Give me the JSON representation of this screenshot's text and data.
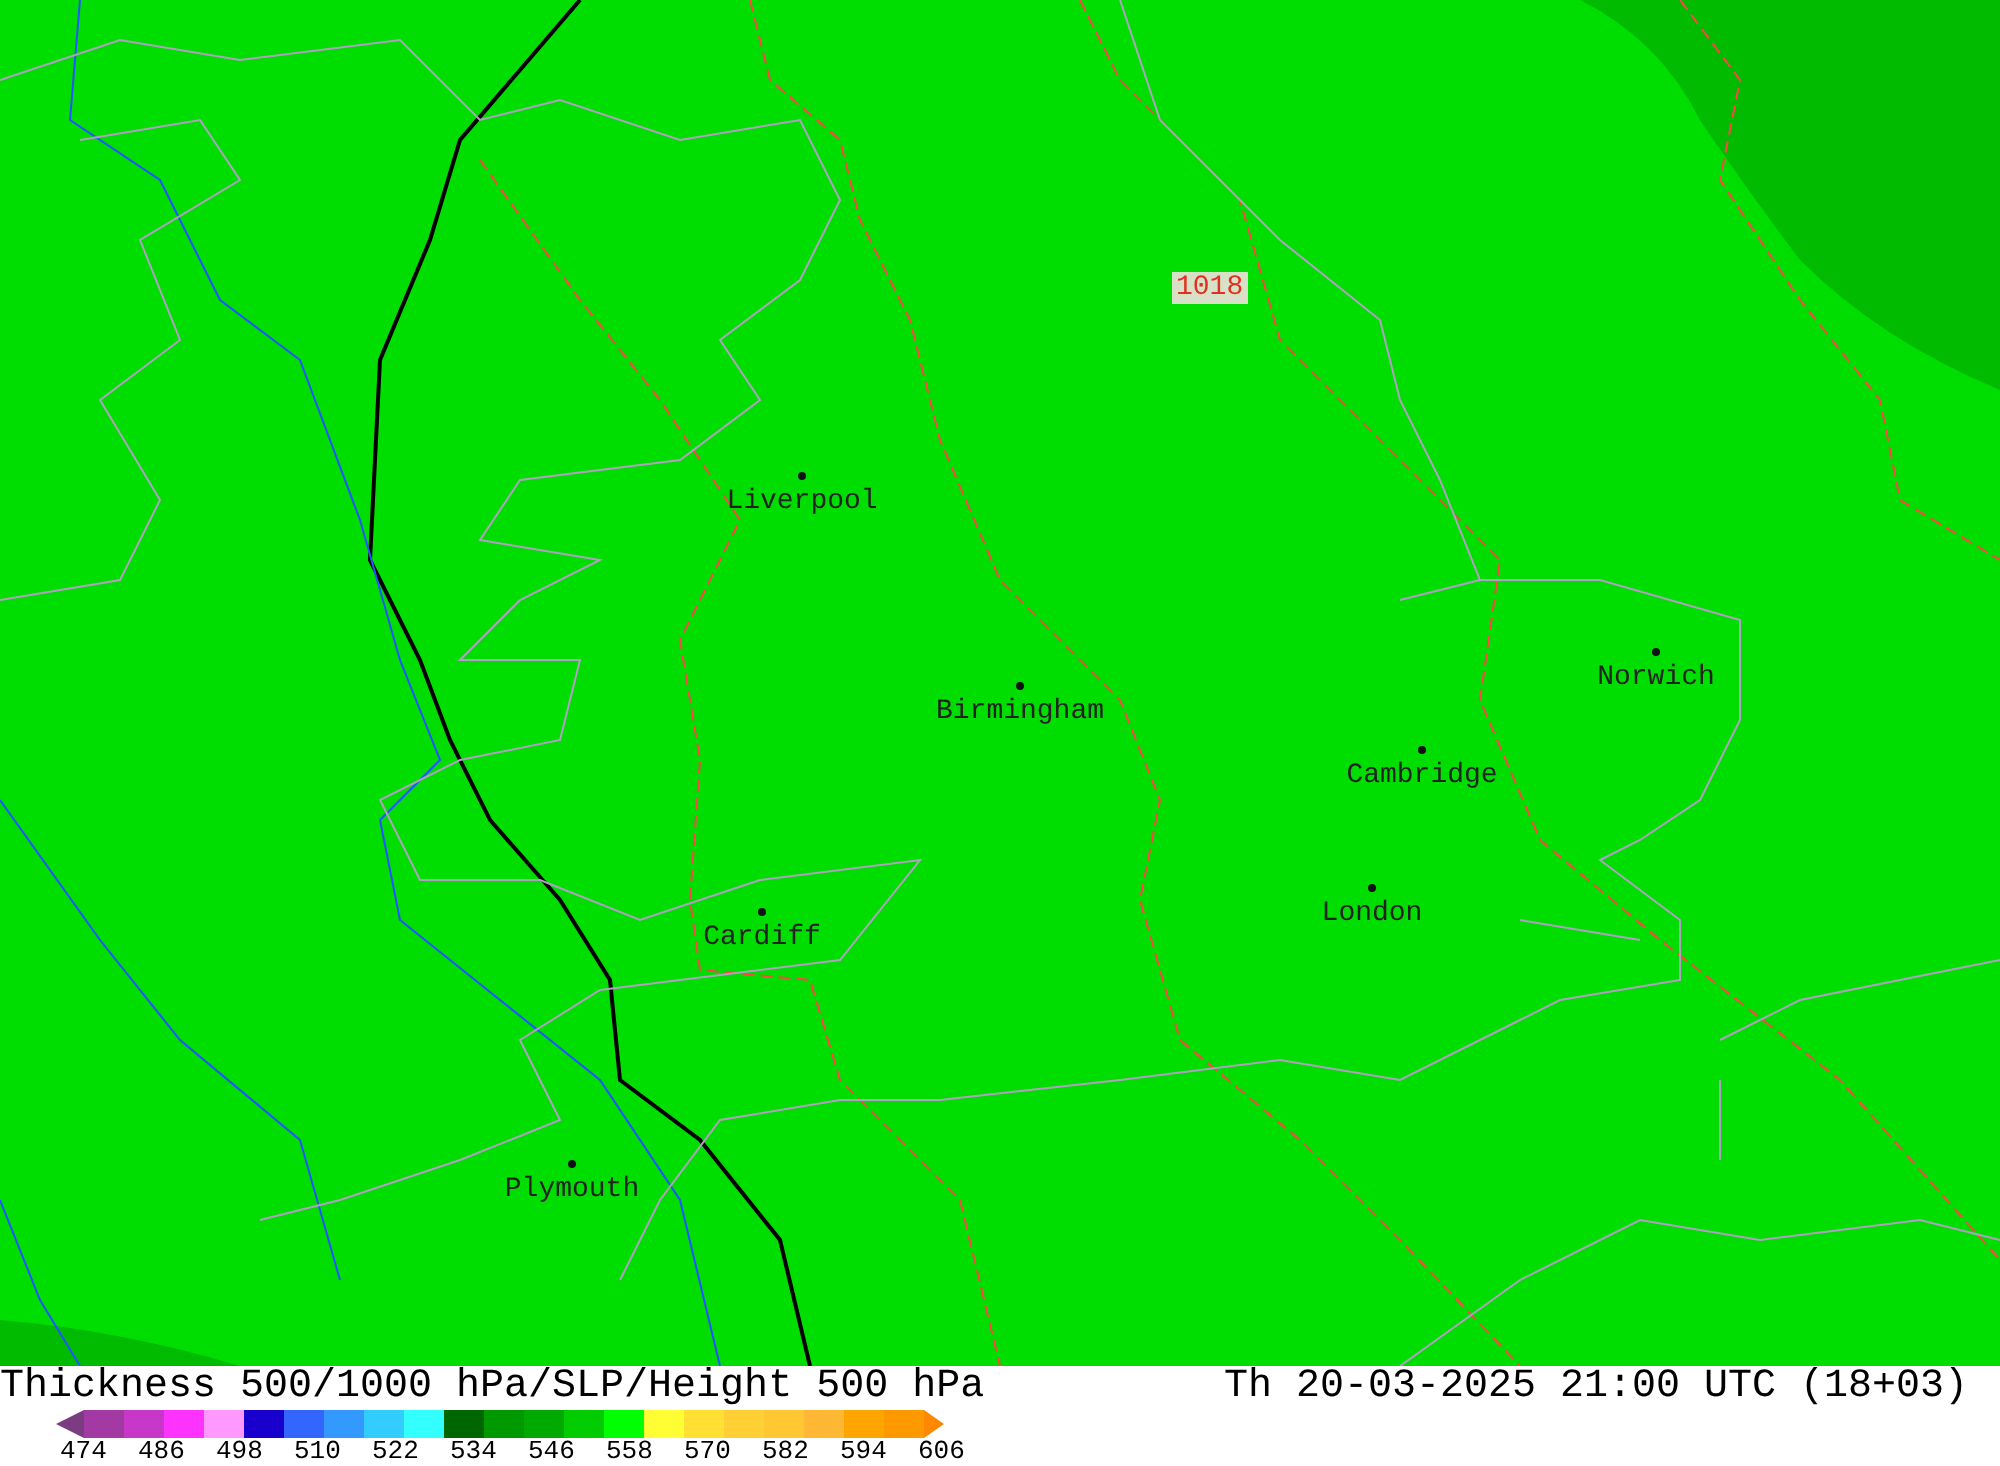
{
  "map": {
    "pressure_label": "1018",
    "cities": [
      "Liverpool",
      "Birmingham",
      "Norwich",
      "Cambridge",
      "London",
      "Cardiff",
      "Plymouth"
    ]
  },
  "footer": {
    "title": "Thickness 500/1000 hPa/SLP/Height 500 hPa",
    "datetime": "Th 20-03-2025 21:00 UTC (18+03)"
  },
  "legend": {
    "swatches": [
      {
        "color": "#7b3c82"
      },
      {
        "color": "#a33aa3"
      },
      {
        "color": "#c838c8"
      },
      {
        "color": "#ff33ff"
      },
      {
        "color": "#ff99ff"
      },
      {
        "color": "#1a00cc"
      },
      {
        "color": "#3366ff"
      },
      {
        "color": "#3399ff"
      },
      {
        "color": "#33ccff"
      },
      {
        "color": "#33ffff"
      },
      {
        "color": "#006600"
      },
      {
        "color": "#009900"
      },
      {
        "color": "#00aa00"
      },
      {
        "color": "#00cc00"
      },
      {
        "color": "#00ff00"
      },
      {
        "color": "#ffff33"
      },
      {
        "color": "#ffe033"
      },
      {
        "color": "#ffd033"
      },
      {
        "color": "#ffc833"
      },
      {
        "color": "#ffb833"
      },
      {
        "color": "#ffa500"
      },
      {
        "color": "#ff9900"
      },
      {
        "color": "#ff8800"
      }
    ],
    "labels": [
      "474",
      "486",
      "498",
      "510",
      "522",
      "534",
      "546",
      "558",
      "570",
      "582",
      "594",
      "606"
    ]
  }
}
